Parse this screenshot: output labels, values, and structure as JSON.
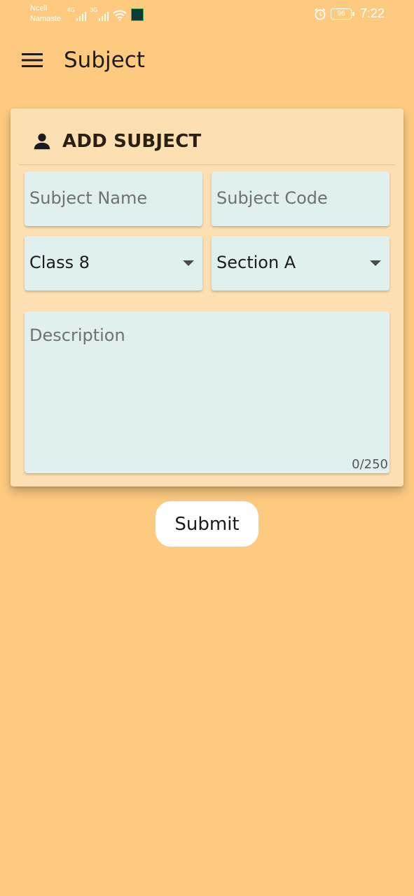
{
  "status_bar": {
    "carrier_line1": "Ncell",
    "carrier_line2": "Namaste",
    "net1": "4G",
    "net2": "3G",
    "battery": "96",
    "time": "7:22",
    "icons": [
      "signal-icon",
      "signal-icon",
      "wifi-icon",
      "app-thumbnail",
      "alarm-icon",
      "battery-icon"
    ]
  },
  "app_bar": {
    "title": "Subject",
    "menu_icon": "hamburger-menu-icon"
  },
  "card": {
    "title": "ADD SUBJECT",
    "icon": "person-icon"
  },
  "form": {
    "subject_name_placeholder": "Subject Name",
    "subject_code_placeholder": "Subject Code",
    "class_value": "Class 8",
    "section_value": "Section A",
    "description_placeholder": "Description",
    "description_counter": "0/250"
  },
  "submit_label": "Submit",
  "colors": {
    "background": "#fdca80",
    "card": "#fde0b2",
    "field": "#dff0ef",
    "button": "#ffffff"
  }
}
